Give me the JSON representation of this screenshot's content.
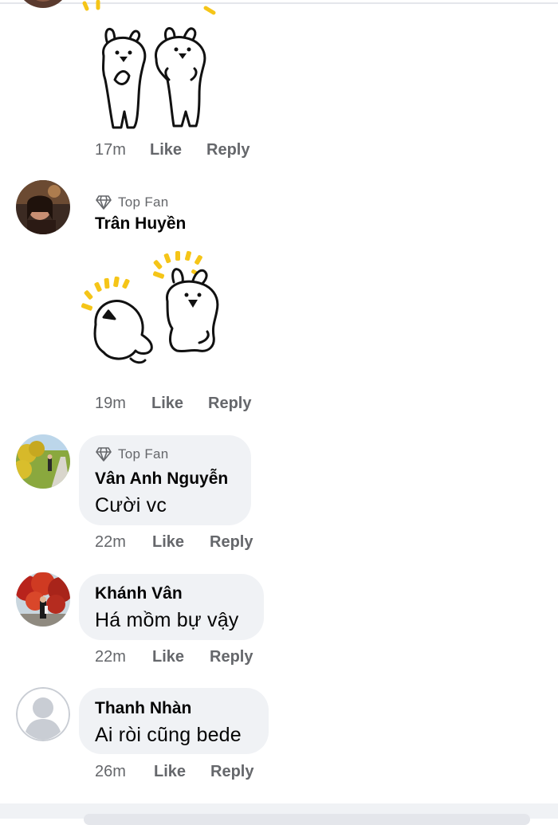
{
  "comments": [
    {
      "id": "c0",
      "author": "",
      "text": "",
      "time": "17m",
      "like": "Like",
      "reply": "Reply",
      "sticker": "bunny-pair-clapping-sticker"
    },
    {
      "id": "c1",
      "badge": "Top Fan",
      "author": "Trân Huyền",
      "time": "19m",
      "like": "Like",
      "reply": "Reply",
      "sticker": "bunny-pair-laughing-sticker"
    },
    {
      "id": "c2",
      "badge": "Top Fan",
      "author": "Vân Anh Nguyễn",
      "text": "Cười vc",
      "time": "22m",
      "like": "Like",
      "reply": "Reply"
    },
    {
      "id": "c3",
      "author": "Khánh Vân",
      "text": "Há mồm bự vậy",
      "time": "22m",
      "like": "Like",
      "reply": "Reply"
    },
    {
      "id": "c4",
      "author": "Thanh Nhàn",
      "text": "Ai ròi cũng bede",
      "time": "26m",
      "like": "Like",
      "reply": "Reply"
    }
  ],
  "icons": {
    "badge": "diamond-icon",
    "default_avatar": "default-avatar-icon"
  },
  "colors": {
    "bubble": "#f0f2f5",
    "meta_text": "#65676b",
    "sticker_accent": "#f5c518"
  }
}
